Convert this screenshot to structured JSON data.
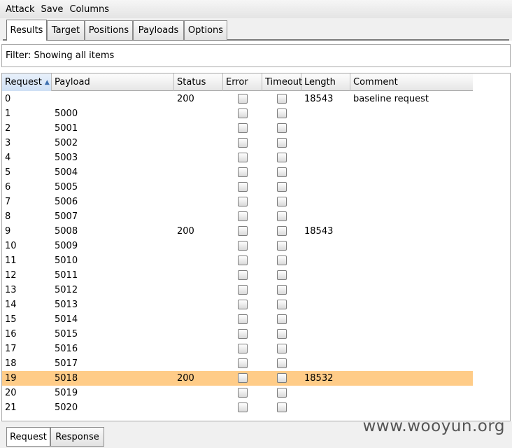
{
  "menu": [
    "Attack",
    "Save",
    "Columns"
  ],
  "tabs": [
    "Results",
    "Target",
    "Positions",
    "Payloads",
    "Options"
  ],
  "active_tab": "Results",
  "filter_text": "Filter: Showing all items",
  "columns": [
    "Request",
    "Payload",
    "Status",
    "Error",
    "Timeout",
    "Length",
    "Comment"
  ],
  "sorted_column": "Request",
  "rows": [
    {
      "request": "0",
      "payload": "",
      "status": "200",
      "length": "18543",
      "comment": "baseline request"
    },
    {
      "request": "1",
      "payload": "5000",
      "status": "",
      "length": "",
      "comment": ""
    },
    {
      "request": "2",
      "payload": "5001",
      "status": "",
      "length": "",
      "comment": ""
    },
    {
      "request": "3",
      "payload": "5002",
      "status": "",
      "length": "",
      "comment": ""
    },
    {
      "request": "4",
      "payload": "5003",
      "status": "",
      "length": "",
      "comment": ""
    },
    {
      "request": "5",
      "payload": "5004",
      "status": "",
      "length": "",
      "comment": ""
    },
    {
      "request": "6",
      "payload": "5005",
      "status": "",
      "length": "",
      "comment": ""
    },
    {
      "request": "7",
      "payload": "5006",
      "status": "",
      "length": "",
      "comment": ""
    },
    {
      "request": "8",
      "payload": "5007",
      "status": "",
      "length": "",
      "comment": ""
    },
    {
      "request": "9",
      "payload": "5008",
      "status": "200",
      "length": "18543",
      "comment": ""
    },
    {
      "request": "10",
      "payload": "5009",
      "status": "",
      "length": "",
      "comment": ""
    },
    {
      "request": "11",
      "payload": "5010",
      "status": "",
      "length": "",
      "comment": ""
    },
    {
      "request": "12",
      "payload": "5011",
      "status": "",
      "length": "",
      "comment": ""
    },
    {
      "request": "13",
      "payload": "5012",
      "status": "",
      "length": "",
      "comment": ""
    },
    {
      "request": "14",
      "payload": "5013",
      "status": "",
      "length": "",
      "comment": ""
    },
    {
      "request": "15",
      "payload": "5014",
      "status": "",
      "length": "",
      "comment": ""
    },
    {
      "request": "16",
      "payload": "5015",
      "status": "",
      "length": "",
      "comment": ""
    },
    {
      "request": "17",
      "payload": "5016",
      "status": "",
      "length": "",
      "comment": ""
    },
    {
      "request": "18",
      "payload": "5017",
      "status": "",
      "length": "",
      "comment": ""
    },
    {
      "request": "19",
      "payload": "5018",
      "status": "200",
      "length": "18532",
      "comment": "",
      "highlighted": true
    },
    {
      "request": "20",
      "payload": "5019",
      "status": "",
      "length": "",
      "comment": ""
    },
    {
      "request": "21",
      "payload": "5020",
      "status": "",
      "length": "",
      "comment": ""
    }
  ],
  "bottom_tabs": [
    "Request",
    "Response"
  ],
  "active_bottom_tab": "Request",
  "watermark": "www.wooyun.org",
  "colors": {
    "highlight_row": "#ffcc88",
    "sort_arrow": "#3c6fb0"
  }
}
